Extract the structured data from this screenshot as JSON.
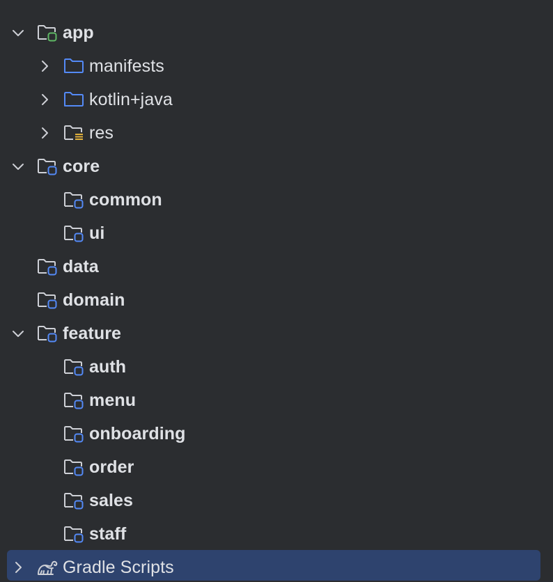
{
  "colors": {
    "background": "#2b2d30",
    "text": "#dfe1e5",
    "selection": "#2e436e",
    "module_badge_blue": "#548af7",
    "module_badge_green": "#5fb865",
    "folder_blue": "#548af7",
    "resource_lines": "#e0b03c",
    "icon_gray": "#ced0d6"
  },
  "tree": {
    "items": [
      {
        "label": "app",
        "icon": "module-folder-green-icon",
        "expanded": true,
        "bold": true
      },
      {
        "label": "manifests",
        "icon": "source-folder-icon",
        "expanded": false,
        "bold": false
      },
      {
        "label": "kotlin+java",
        "icon": "source-folder-icon",
        "expanded": false,
        "bold": false
      },
      {
        "label": "res",
        "icon": "resources-folder-icon",
        "expanded": false,
        "bold": false
      },
      {
        "label": "core",
        "icon": "module-folder-icon",
        "expanded": true,
        "bold": true
      },
      {
        "label": "common",
        "icon": "module-folder-icon",
        "bold": true
      },
      {
        "label": "ui",
        "icon": "module-folder-icon",
        "bold": true
      },
      {
        "label": "data",
        "icon": "module-folder-icon",
        "bold": true
      },
      {
        "label": "domain",
        "icon": "module-folder-icon",
        "bold": true
      },
      {
        "label": "feature",
        "icon": "module-folder-icon",
        "expanded": true,
        "bold": true
      },
      {
        "label": "auth",
        "icon": "module-folder-icon",
        "bold": true
      },
      {
        "label": "menu",
        "icon": "module-folder-icon",
        "bold": true
      },
      {
        "label": "onboarding",
        "icon": "module-folder-icon",
        "bold": true
      },
      {
        "label": "order",
        "icon": "module-folder-icon",
        "bold": true
      },
      {
        "label": "sales",
        "icon": "module-folder-icon",
        "bold": true
      },
      {
        "label": "staff",
        "icon": "module-folder-icon",
        "bold": true
      },
      {
        "label": "Gradle Scripts",
        "icon": "gradle-elephant-icon",
        "expanded": false,
        "bold": false,
        "selected": true
      }
    ]
  }
}
